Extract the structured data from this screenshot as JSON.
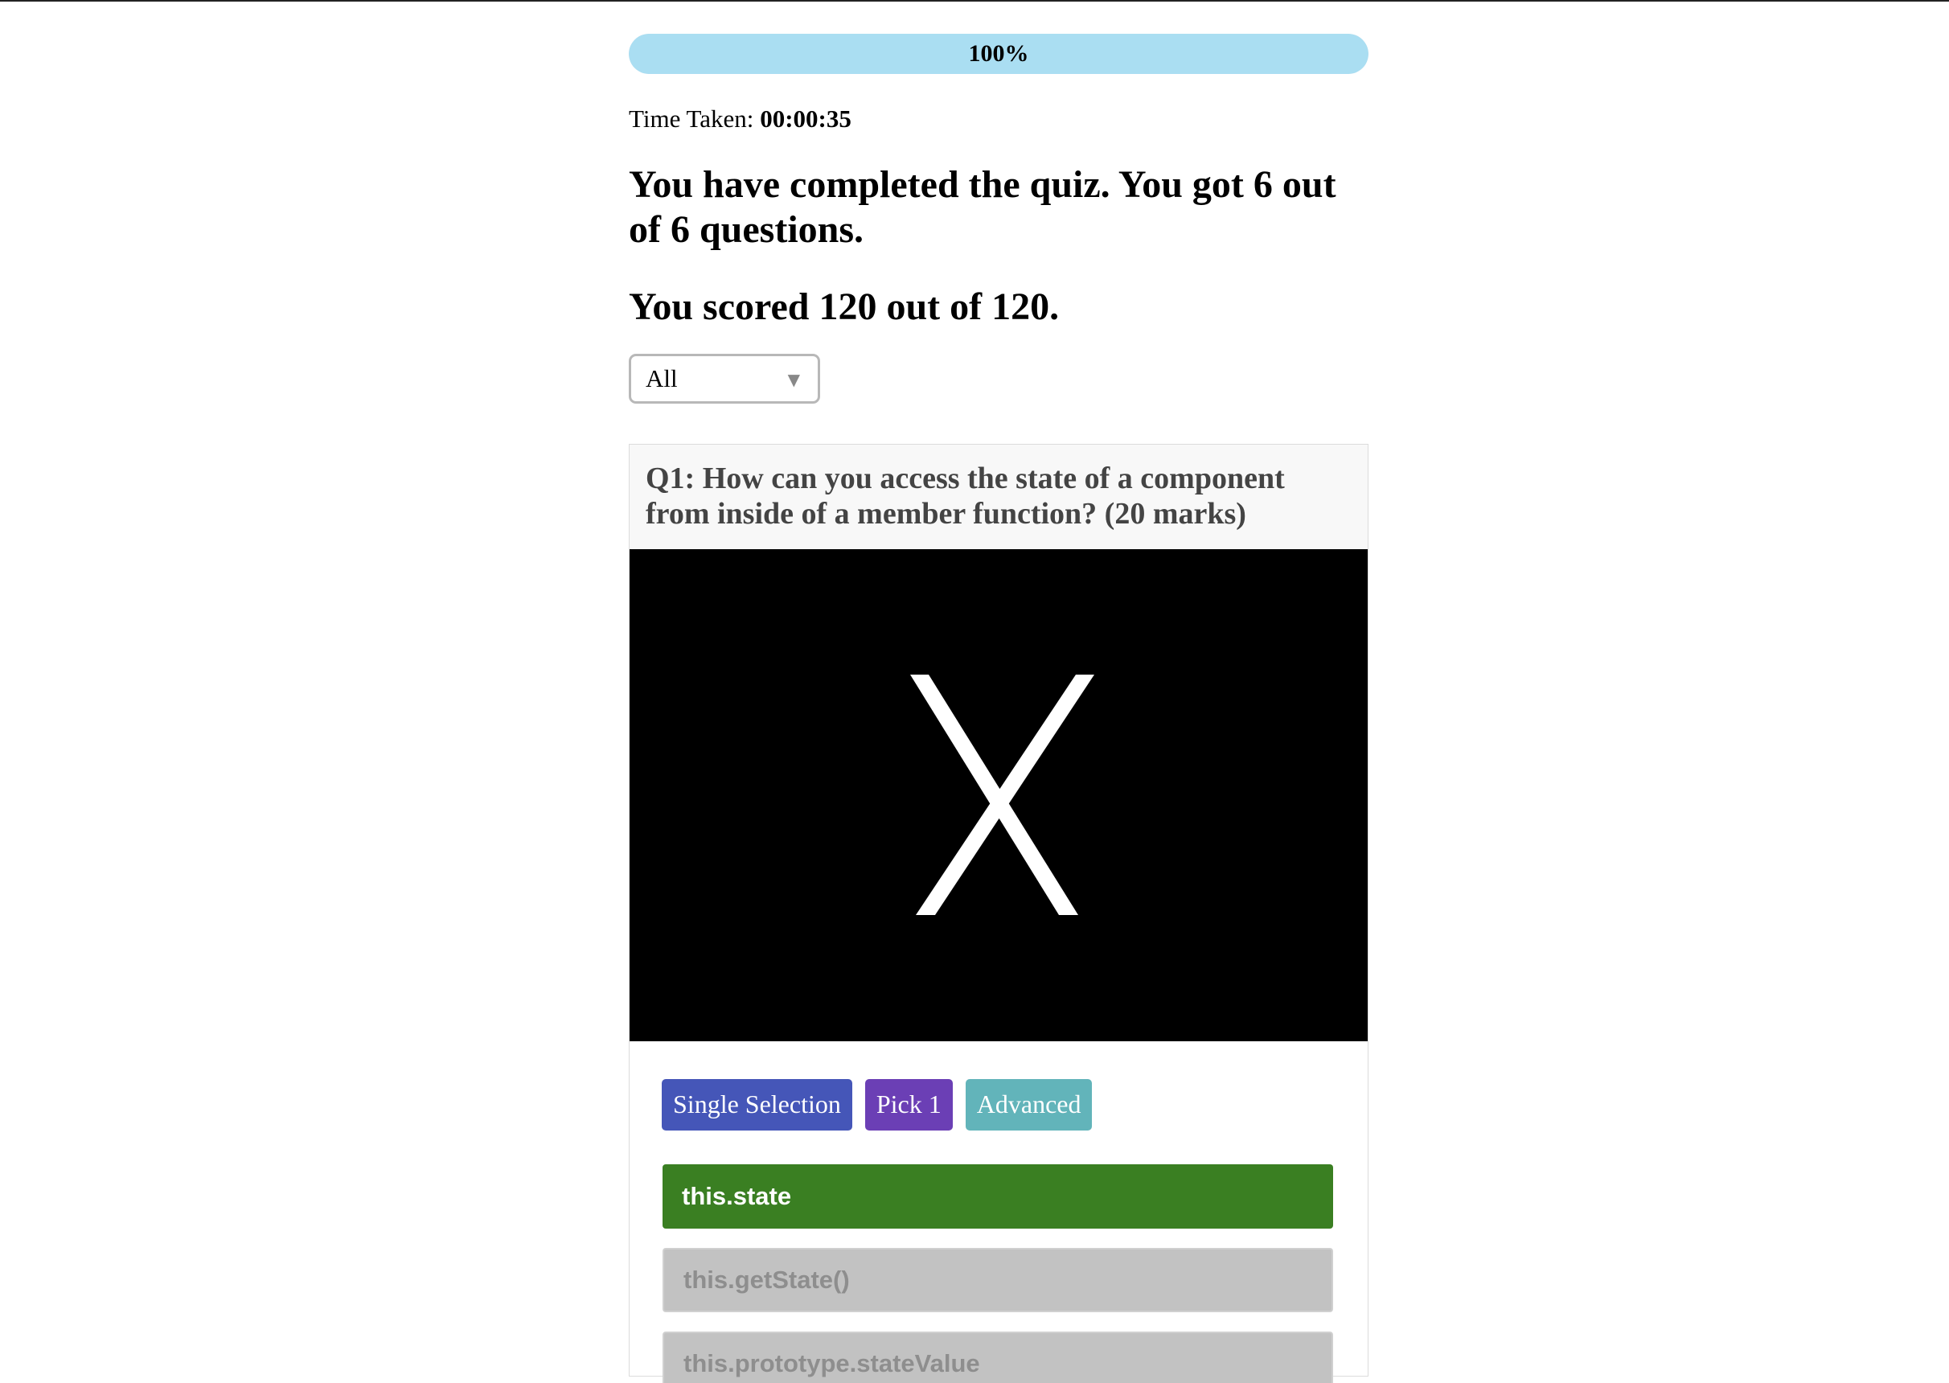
{
  "progress": {
    "label": "100%",
    "fraction": 1.0
  },
  "time": {
    "label": "Time Taken:",
    "value": "00:00:35"
  },
  "result": {
    "summary": "You have completed the quiz. You got 6 out of 6 questions.",
    "score": "You scored 120 out of 120."
  },
  "filter": {
    "selected": "All",
    "arrow": "▼"
  },
  "question": {
    "title": "Q1: How can you access the state of a component from inside of a member function? (20 marks)",
    "image_icon": "x-image",
    "tags": {
      "type": "Single Selection",
      "pick": "Pick 1",
      "level": "Advanced"
    },
    "options": [
      {
        "label": "this.state",
        "status": "correct"
      },
      {
        "label": "this.getState()",
        "status": "unselected"
      },
      {
        "label": "this.prototype.stateValue",
        "status": "unselected"
      }
    ]
  },
  "colors": {
    "progress_fill": "#aadef2",
    "correct_option": "#3a7f22",
    "unselected_option": "#c2c2c2",
    "tag_type": "#4556b8",
    "tag_pick": "#6b3fb5",
    "tag_level": "#62b4ba"
  }
}
